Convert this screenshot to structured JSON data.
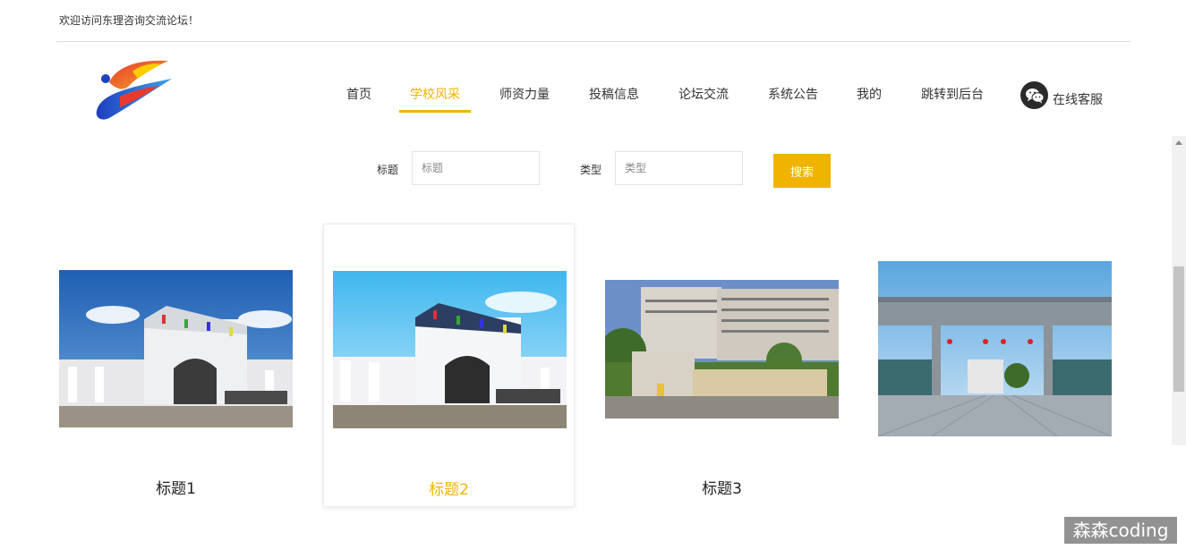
{
  "header": {
    "welcome_text": "欢迎访问东理咨询交流论坛！"
  },
  "nav": {
    "items": [
      {
        "label": "首页"
      },
      {
        "label": "学校风采",
        "active": true
      },
      {
        "label": "师资力量"
      },
      {
        "label": "投稿信息"
      },
      {
        "label": "论坛交流"
      },
      {
        "label": "系统公告"
      },
      {
        "label": "我的"
      },
      {
        "label": "跳转到后台"
      }
    ],
    "service_label": "在线客服",
    "service_icon": "wechat-icon"
  },
  "search": {
    "title_label": "标题",
    "title_placeholder": "标题",
    "title_value": "",
    "type_label": "类型",
    "type_placeholder": "类型",
    "type_value": "",
    "button_label": "搜索"
  },
  "cards": [
    {
      "title": "标题1",
      "image": "university-gate-photo"
    },
    {
      "title": "标题2",
      "image": "university-gate-photo"
    },
    {
      "title": "标题3",
      "image": "campus-sign-photo"
    },
    {
      "title": "",
      "image": "university-gate-plaza-photo"
    }
  ],
  "watermark": "森森coding",
  "colors": {
    "accent": "#f0b400",
    "text": "#333333"
  }
}
